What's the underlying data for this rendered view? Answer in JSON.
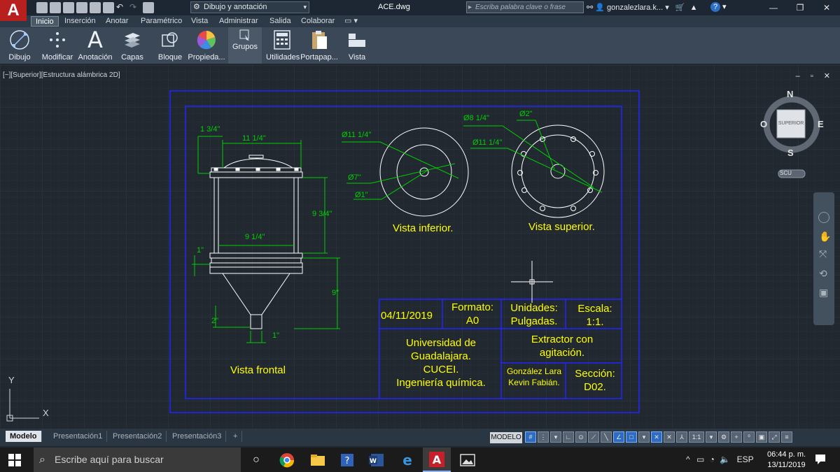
{
  "app": {
    "logo_letter": "A"
  },
  "titlebar": {
    "workspace": "Dibujo y anotación",
    "file_name": "ACE.dwg",
    "search_placeholder": "Escriba palabra clave o frase",
    "user": "gonzalezlara.k...",
    "help": "?"
  },
  "tabs": [
    "Inicio",
    "Inserción",
    "Anotar",
    "Paramétrico",
    "Vista",
    "Administrar",
    "Salida",
    "Colaborar"
  ],
  "ribbon": {
    "buttons": [
      "Dibujo",
      "Modificar",
      "Anotación",
      "Capas",
      "Bloque",
      "Propieda...",
      "Grupos",
      "Utilidades",
      "Portapap...",
      "Vista"
    ]
  },
  "viewport": {
    "label": "[−][Superior][Estructura alámbrica 2D]",
    "controls": "– ▫ ✕"
  },
  "viewcube": {
    "n": "N",
    "s": "S",
    "e": "E",
    "o": "O",
    "face": "SUPERIOR",
    "ucs": "SCU"
  },
  "ucs_axes": {
    "x": "X",
    "y": "Y"
  },
  "drawing": {
    "front_view": {
      "title": "Vista frontal",
      "dims": [
        "1 3/4\"",
        "11 1/4\"",
        "9 3/4\"",
        "9 1/4\"",
        "1\"",
        "9\"",
        "2\"",
        "1\""
      ]
    },
    "bottom_view": {
      "title": "Vista inferior.",
      "dims": [
        "Ø11 1/4\"",
        "Ø7\"",
        "Ø1\""
      ]
    },
    "top_view": {
      "title": "Vista superior.",
      "dims": [
        "Ø8 1/4\"",
        "Ø2\"",
        "Ø11 1/4\""
      ]
    },
    "title_block": {
      "date": "04/11/2019",
      "format_label": "Formato:",
      "format_value": "A0",
      "units_label": "Unidades:",
      "units_value": "Pulgadas.",
      "scale_label": "Escala:",
      "scale_value": "1:1.",
      "institution": [
        "Universidad de",
        "Guadalajara.",
        "CUCEI.",
        "Ingeniería química."
      ],
      "project": [
        "Extractor con",
        "agitación."
      ],
      "author": [
        "González Lara",
        "Kevin Fabián."
      ],
      "section_label": "Sección:",
      "section_value": "D02."
    }
  },
  "layout_tabs": [
    "Modelo",
    "Presentación1",
    "Presentación2",
    "Presentación3",
    "+"
  ],
  "status": {
    "model": "MODELO",
    "scale": "1:1"
  },
  "taskbar": {
    "search": "Escribe aquí para buscar",
    "lang": "ESP",
    "time": "06:44 p. m.",
    "date": "13/11/2019"
  },
  "colors": {
    "drawing_blue": "#1a1aff",
    "dim_green": "#00d000",
    "text_yellow": "#ffff00",
    "geom_white": "#ffffff",
    "canvas_bg": "#212830"
  }
}
